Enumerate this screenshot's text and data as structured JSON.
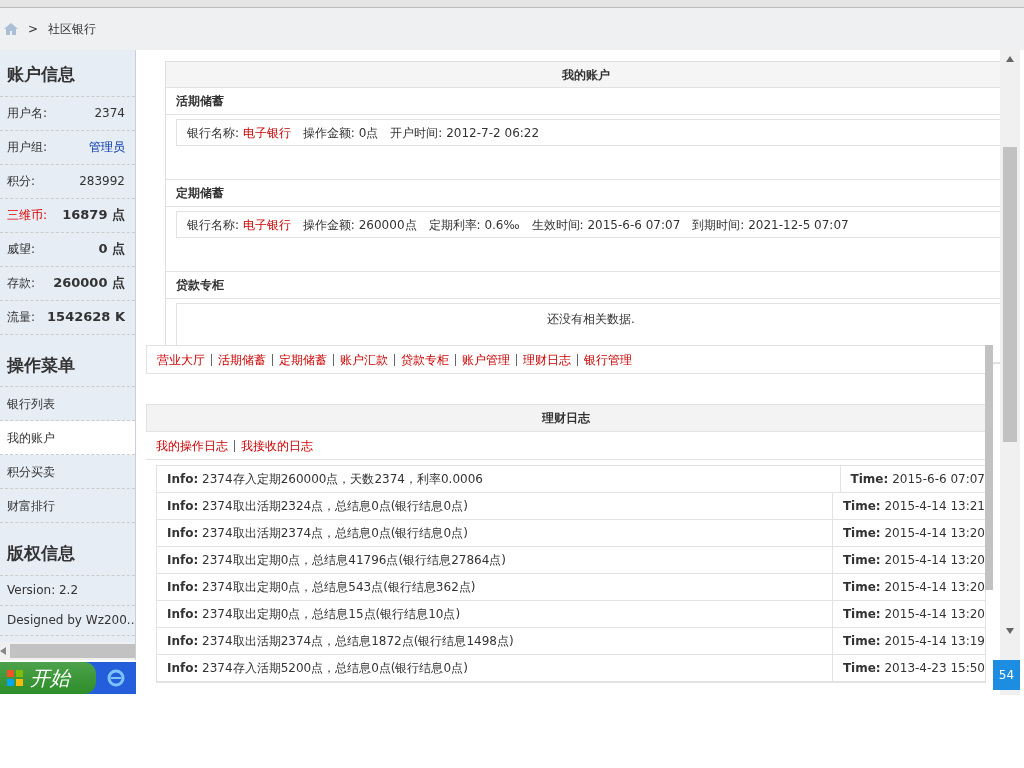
{
  "breadcrumb": {
    "separator": ">",
    "current": "社区银行"
  },
  "account_info": {
    "title": "账户信息",
    "rows": [
      {
        "label": "用户名:",
        "value": "2374",
        "kind": "plain"
      },
      {
        "label": "用户组:",
        "value": "管理员",
        "kind": "link"
      },
      {
        "label": "积分:",
        "value": "283992",
        "kind": "plain"
      },
      {
        "label": "三维币:",
        "value": "16879 点",
        "kind": "highlight"
      },
      {
        "label": "威望:",
        "value": "0 点",
        "kind": "bold"
      },
      {
        "label": "存款:",
        "value": "260000 点",
        "kind": "bold"
      },
      {
        "label": "流量:",
        "value": "1542628 K",
        "kind": "bold"
      }
    ]
  },
  "menu": {
    "title": "操作菜单",
    "items": [
      {
        "label": "银行列表",
        "selected": false
      },
      {
        "label": "我的账户",
        "selected": true
      },
      {
        "label": "积分买卖",
        "selected": false
      },
      {
        "label": "财富排行",
        "selected": false
      }
    ]
  },
  "copyright": {
    "title": "版权信息",
    "lines": [
      "Version: 2.2",
      "Designed by Wz200.."
    ]
  },
  "account_panel": {
    "title": "我的账户",
    "sections": [
      {
        "title": "活期储蓄",
        "fields": [
          {
            "label": "银行名称:",
            "value": "电子银行",
            "kind": "link"
          },
          {
            "label": "操作金额:",
            "value": "0点",
            "kind": "plain"
          },
          {
            "label": "开户时间:",
            "value": "2012-7-2 06:22",
            "kind": "plain"
          }
        ]
      },
      {
        "title": "定期储蓄",
        "fields": [
          {
            "label": "银行名称:",
            "value": "电子银行",
            "kind": "link"
          },
          {
            "label": "操作金额:",
            "value": "260000点",
            "kind": "plain"
          },
          {
            "label": "定期利率:",
            "value": "0.6‰",
            "kind": "plain"
          },
          {
            "label": "生效时间:",
            "value": "2015-6-6 07:07",
            "kind": "plain"
          },
          {
            "label": "到期时间:",
            "value": "2021-12-5 07:07",
            "kind": "plain"
          }
        ]
      },
      {
        "title": "贷款专柜",
        "empty_text": "还没有相关数据."
      }
    ]
  },
  "nav_links": [
    "营业大厅",
    "活期储蓄",
    "定期储蓄",
    "账户汇款",
    "贷款专柜",
    "账户管理",
    "理财日志",
    "银行管理"
  ],
  "log_panel": {
    "title": "理财日志",
    "tabs": [
      "我的操作日志",
      "我接收的日志"
    ],
    "rows": [
      {
        "info": "**Info:** 2374存入定期260000点，天数2374，利率0.0006",
        "time": "**Time:** 2015-6-6 07:07"
      },
      {
        "info": "**Info:** 2374取出活期2324点，总结息0点(银行结息0点)",
        "time": "**Time:** 2015-4-14 13:21"
      },
      {
        "info": "**Info:** 2374取出活期2374点，总结息0点(银行结息0点)",
        "time": "**Time:** 2015-4-14 13:20"
      },
      {
        "info": "**Info:** 2374取出定期0点，总结息41796点(银行结息27864点)",
        "time": "**Time:** 2015-4-14 13:20"
      },
      {
        "info": "**Info:** 2374取出定期0点，总结息543点(银行结息362点)",
        "time": "**Time:** 2015-4-14 13:20"
      },
      {
        "info": "**Info:** 2374取出定期0点，总结息15点(银行结息10点)",
        "time": "**Time:** 2015-4-14 13:20"
      },
      {
        "info": "**Info:** 2374取出活期2374点，总结息1872点(银行结息1498点)",
        "time": "**Time:** 2015-4-14 13:19"
      },
      {
        "info": "**Info:** 2374存入活期5200点，总结息0点(银行结息0点)",
        "time": "**Time:** 2013-4-23 15:50"
      }
    ]
  },
  "taskbar": {
    "start": "开始",
    "clock": "54"
  }
}
